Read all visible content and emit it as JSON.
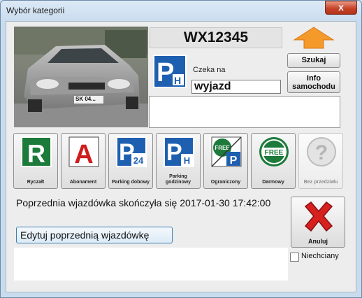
{
  "window": {
    "title": "Wybór kategorii",
    "close_glyph": "x"
  },
  "vehicle": {
    "plate": "WX12345",
    "plate_on_photo": "SK 04..."
  },
  "buttons": {
    "search": "Szukaj",
    "info": "Info samochodu",
    "edit_previous": "Edytuj poprzednią wjazdówkę",
    "cancel": "Anuluj"
  },
  "wait": {
    "label": "Czeka na",
    "value": "wyjazd"
  },
  "status_icon": {
    "name": "parking-hourly-icon",
    "letter": "P",
    "sub": "H"
  },
  "categories": [
    {
      "label": "Ryczałt",
      "icon": "r-green-icon",
      "glyph": "R"
    },
    {
      "label": "Abonament",
      "icon": "a-red-icon",
      "glyph": "A"
    },
    {
      "label": "Parking dobowy",
      "icon": "parking-24-icon",
      "glyph": "P",
      "sub": "24"
    },
    {
      "label": "Parking godzinowy",
      "icon": "parking-h-icon",
      "glyph": "P",
      "sub": "H"
    },
    {
      "label": "Ograniczony",
      "icon": "free-p-icon",
      "glyph": "FREE",
      "sub": "P"
    },
    {
      "label": "Darmowy",
      "icon": "free-icon",
      "glyph": "FREE"
    },
    {
      "label": "Bez przedziału",
      "icon": "question-icon",
      "glyph": "?",
      "disabled": true
    }
  ],
  "message": "Poprzednia wjazdówka skończyła się 2017-01-30 17:42:00",
  "checkbox": {
    "label": "Niechciany",
    "checked": false
  },
  "colors": {
    "accent_blue": "#1f5fb0",
    "green": "#1c7a3a",
    "red": "#cf1d1d",
    "close_red": "#c7442a",
    "arrow_orange": "#f49a2a"
  }
}
